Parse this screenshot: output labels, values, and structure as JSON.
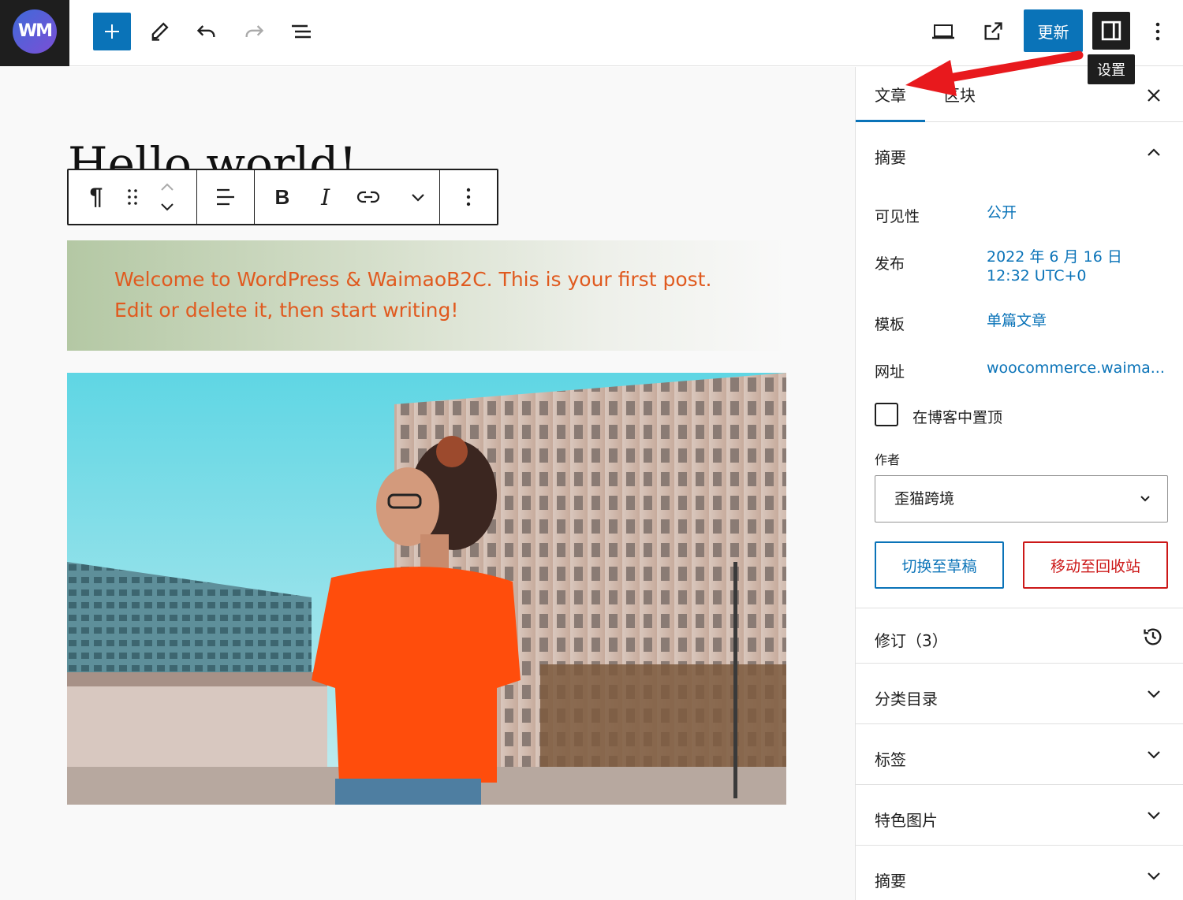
{
  "app": {
    "logo_text": "WM",
    "update_label": "更新",
    "settings_tooltip": "设置"
  },
  "editor": {
    "post_title": "Hello world!",
    "paragraph_text": "Welcome to WordPress & WaimaoB2C. This is your first post. Edit or delete it, then start writing!",
    "block_toolbar": {
      "paragraph_icon": "¶",
      "bold": "B",
      "italic": "I"
    }
  },
  "sidebar": {
    "tabs": [
      {
        "label": "文章",
        "active": true
      },
      {
        "label": "区块",
        "active": false
      }
    ],
    "summary_panel": {
      "title": "摘要",
      "rows": [
        {
          "label": "可见性",
          "value": "公开"
        },
        {
          "label": "发布",
          "value_line1": "2022 年 6 月 16 日",
          "value_line2": "12:32 UTC+0"
        },
        {
          "label": "模板",
          "value": "单篇文章"
        },
        {
          "label": "网址",
          "value": "woocommerce.waima..."
        }
      ],
      "sticky_label": "在博客中置顶",
      "author_label": "作者",
      "author_value": "歪猫跨境",
      "draft_button": "切换至草稿",
      "trash_button": "移动至回收站"
    },
    "revisions_label": "修订（3）",
    "panels": [
      {
        "label": "分类目录"
      },
      {
        "label": "标签"
      },
      {
        "label": "特色图片"
      },
      {
        "label": "摘要"
      }
    ]
  },
  "colors": {
    "accent": "#0a73b8",
    "danger": "#cc1818",
    "paragraph_text": "#e05a1f",
    "annotation_arrow": "#e8191d"
  }
}
